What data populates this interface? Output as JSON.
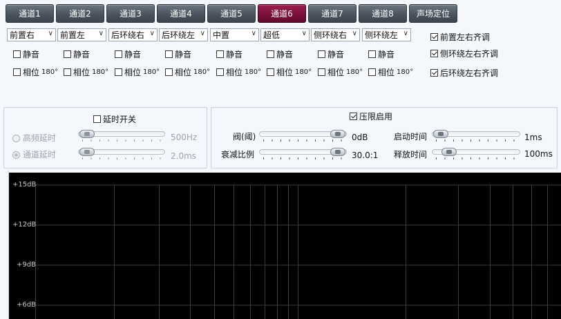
{
  "tabs": [
    {
      "label": "通道1",
      "active": false
    },
    {
      "label": "通道2",
      "active": false
    },
    {
      "label": "通道3",
      "active": false
    },
    {
      "label": "通道4",
      "active": false
    },
    {
      "label": "通道5",
      "active": false
    },
    {
      "label": "通道6",
      "active": true
    },
    {
      "label": "通道7",
      "active": false
    },
    {
      "label": "通道8",
      "active": false
    },
    {
      "label": "声场定位",
      "active": false
    }
  ],
  "channel_selects": [
    "前置右",
    "前置左",
    "后环绕右",
    "后环绕左",
    "中置",
    "超低",
    "侧环绕右",
    "侧环绕左"
  ],
  "mute_label": "静音",
  "phase_label": "相位",
  "phase_value": "180°",
  "align": [
    {
      "label": "前置左右齐调",
      "checked": true
    },
    {
      "label": "侧环绕左右齐调",
      "checked": true
    },
    {
      "label": "后环绕左右齐调",
      "checked": true
    }
  ],
  "delay_panel": {
    "switch_label": "延时开关",
    "switch_checked": false,
    "hf_delay_label": "高频延时",
    "hf_delay_value": "500Hz",
    "ch_delay_label": "通道延时",
    "ch_delay_value": "2.0ms"
  },
  "limiter_panel": {
    "enable_label": "压限启用",
    "enable_checked": true,
    "threshold_label": "阀(阈)",
    "threshold_value": "0dB",
    "ratio_label": "衰减比例",
    "ratio_value": "30.0:1",
    "attack_label": "启动时间",
    "attack_value": "1ms",
    "release_label": "释放时间",
    "release_value": "100ms"
  },
  "graph": {
    "y_labels": [
      "+15dB",
      "+12dB",
      "+9dB",
      "+6dB"
    ],
    "background": "#000000",
    "grid_color": "#3a3a3a"
  },
  "colors": {
    "active_tab": "#7a0f3a",
    "tab": "#4b545e"
  }
}
